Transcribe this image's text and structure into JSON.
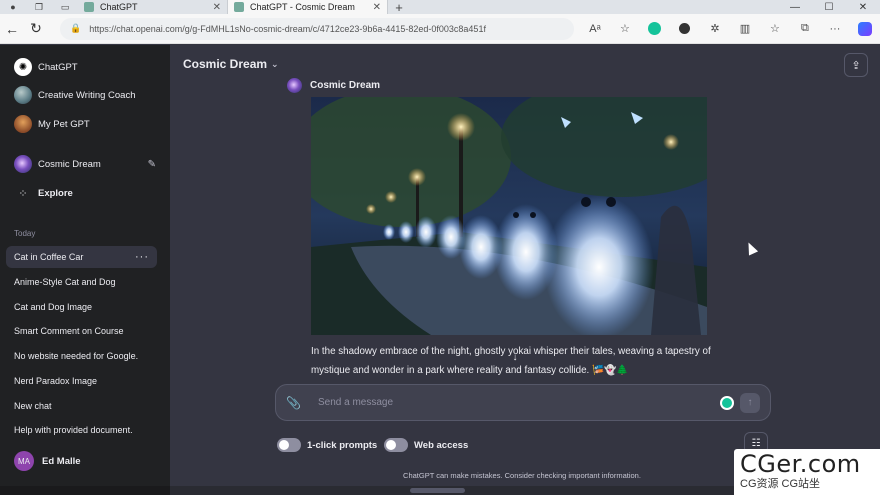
{
  "browser": {
    "tabs": [
      {
        "title": "ChatGPT",
        "active": false
      },
      {
        "title": "ChatGPT - Cosmic Dream",
        "active": true
      }
    ],
    "url": "https://chat.openai.com/g/g-FdMHL1sNo-cosmic-dream/c/4712ce23-9b6a-4415-82ed-0f003c8a451f",
    "reader_label": "Aᵃ"
  },
  "sidebar": {
    "gpts": [
      {
        "label": "ChatGPT",
        "icon": "chatgpt-logo-icon"
      },
      {
        "label": "Creative Writing Coach",
        "icon": "creative-writing-coach-avatar"
      },
      {
        "label": "My Pet GPT",
        "icon": "my-pet-gpt-avatar"
      }
    ],
    "current_gpt": {
      "label": "Cosmic Dream",
      "icon": "cosmic-dream-avatar"
    },
    "explore_label": "Explore",
    "section_today": "Today",
    "chats": [
      {
        "label": "Cat in Coffee Car",
        "active": true
      },
      {
        "label": "Anime-Style Cat and Dog",
        "active": false
      },
      {
        "label": "Cat and Dog Image",
        "active": false
      },
      {
        "label": "Smart Comment on Course",
        "active": false
      },
      {
        "label": "No website needed for Google.",
        "active": false
      },
      {
        "label": "Nerd Paradox Image",
        "active": false
      },
      {
        "label": "New chat",
        "active": false
      },
      {
        "label": "Help with provided document.",
        "active": false
      }
    ],
    "user": {
      "initials": "MA",
      "name": "Ed Malle"
    }
  },
  "main": {
    "model_title": "Cosmic Dream",
    "message": {
      "author": "Cosmic Dream",
      "text": "In the shadowy embrace of the night, ghostly yokai whisper their tales, weaving a tapestry of mystique and wonder in a park where reality and fantasy collide. 🎏👻🌲"
    },
    "composer": {
      "placeholder": "Send a message"
    },
    "toggles": [
      {
        "label": "1-click prompts",
        "on": false
      },
      {
        "label": "Web access",
        "on": false
      }
    ],
    "disclaimer": "ChatGPT can make mistakes. Consider checking important information."
  },
  "watermark": {
    "main": "CGer.com",
    "sub": "CG资源 CG站坐"
  },
  "colors": {
    "sidebar_bg": "#202123",
    "main_bg": "#343541",
    "composer_bg": "#40414f",
    "text": "#ececf1",
    "muted": "#8e8ea0",
    "accent_grammarly": "#15c39a",
    "user_avatar": "#8e44ad"
  }
}
